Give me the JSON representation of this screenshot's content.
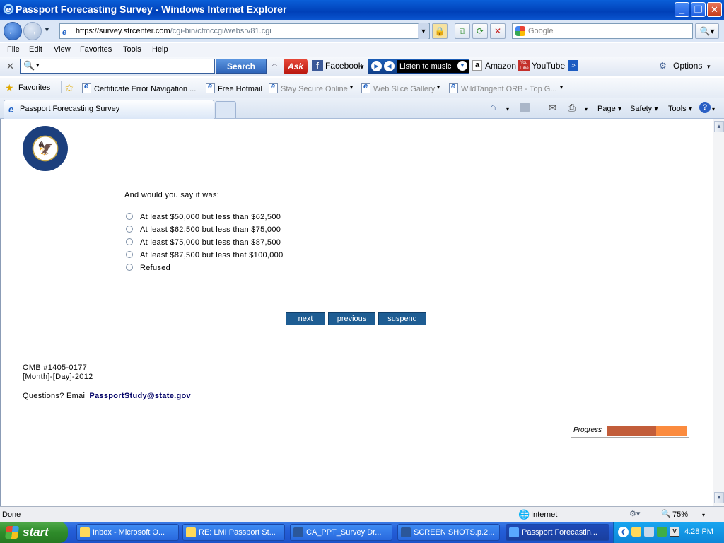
{
  "window": {
    "title": "Passport Forecasting Survey - Windows Internet Explorer"
  },
  "address": {
    "protocol": "https://",
    "host": "survey.strcenter.com",
    "path": "/cgi-bin/cfmccgi/websrv81.cgi"
  },
  "search_box": {
    "placeholder": "Google"
  },
  "menu": [
    "File",
    "Edit",
    "View",
    "Favorites",
    "Tools",
    "Help"
  ],
  "ask_toolbar": {
    "search_label": "Search",
    "logo": "Ask",
    "facebook": "Facebook",
    "music": "Listen to music",
    "amazon": "Amazon",
    "youtube": "YouTube",
    "options": "Options"
  },
  "favorites_bar": {
    "label": "Favorites",
    "items": [
      "Certificate Error Navigation ...",
      "Free Hotmail",
      "Stay Secure Online",
      "Web Slice Gallery",
      "WildTangent ORB - Top G..."
    ]
  },
  "tab": {
    "title": "Passport Forecasting Survey"
  },
  "commandbar": {
    "page": "Page",
    "safety": "Safety",
    "tools": "Tools"
  },
  "survey": {
    "question": "And would you say it was:",
    "options": [
      "At least $50,000 but less than $62,500",
      "At least $62,500 but less than $75,000",
      "At least $75,000 but less than $87,500",
      "At least $87,500 but less that $100,000",
      "Refused"
    ],
    "buttons": {
      "next": "next",
      "previous": "previous",
      "suspend": "suspend"
    },
    "omb": "OMB #1405-0177",
    "date": "[Month]-[Day]-2012",
    "questions_prefix": "Questions? Email ",
    "email": "PassportStudy@state.gov",
    "progress_label": "Progress",
    "progress_fraction": 0.61
  },
  "statusbar": {
    "status": "Done",
    "zone": "Internet",
    "zoom": "75%"
  },
  "taskbar": {
    "start": "start",
    "tasks": [
      "Inbox - Microsoft O...",
      "RE: LMI Passport St...",
      "CA_PPT_Survey Dr...",
      "SCREEN SHOTS.p.2...",
      "Passport Forecastin..."
    ],
    "clock": "4:28 PM"
  },
  "colors": {
    "button": "#1e5d93",
    "progress_fill": "#c25d3a",
    "progress_track": "#fb8b3e",
    "link": "#000066"
  }
}
